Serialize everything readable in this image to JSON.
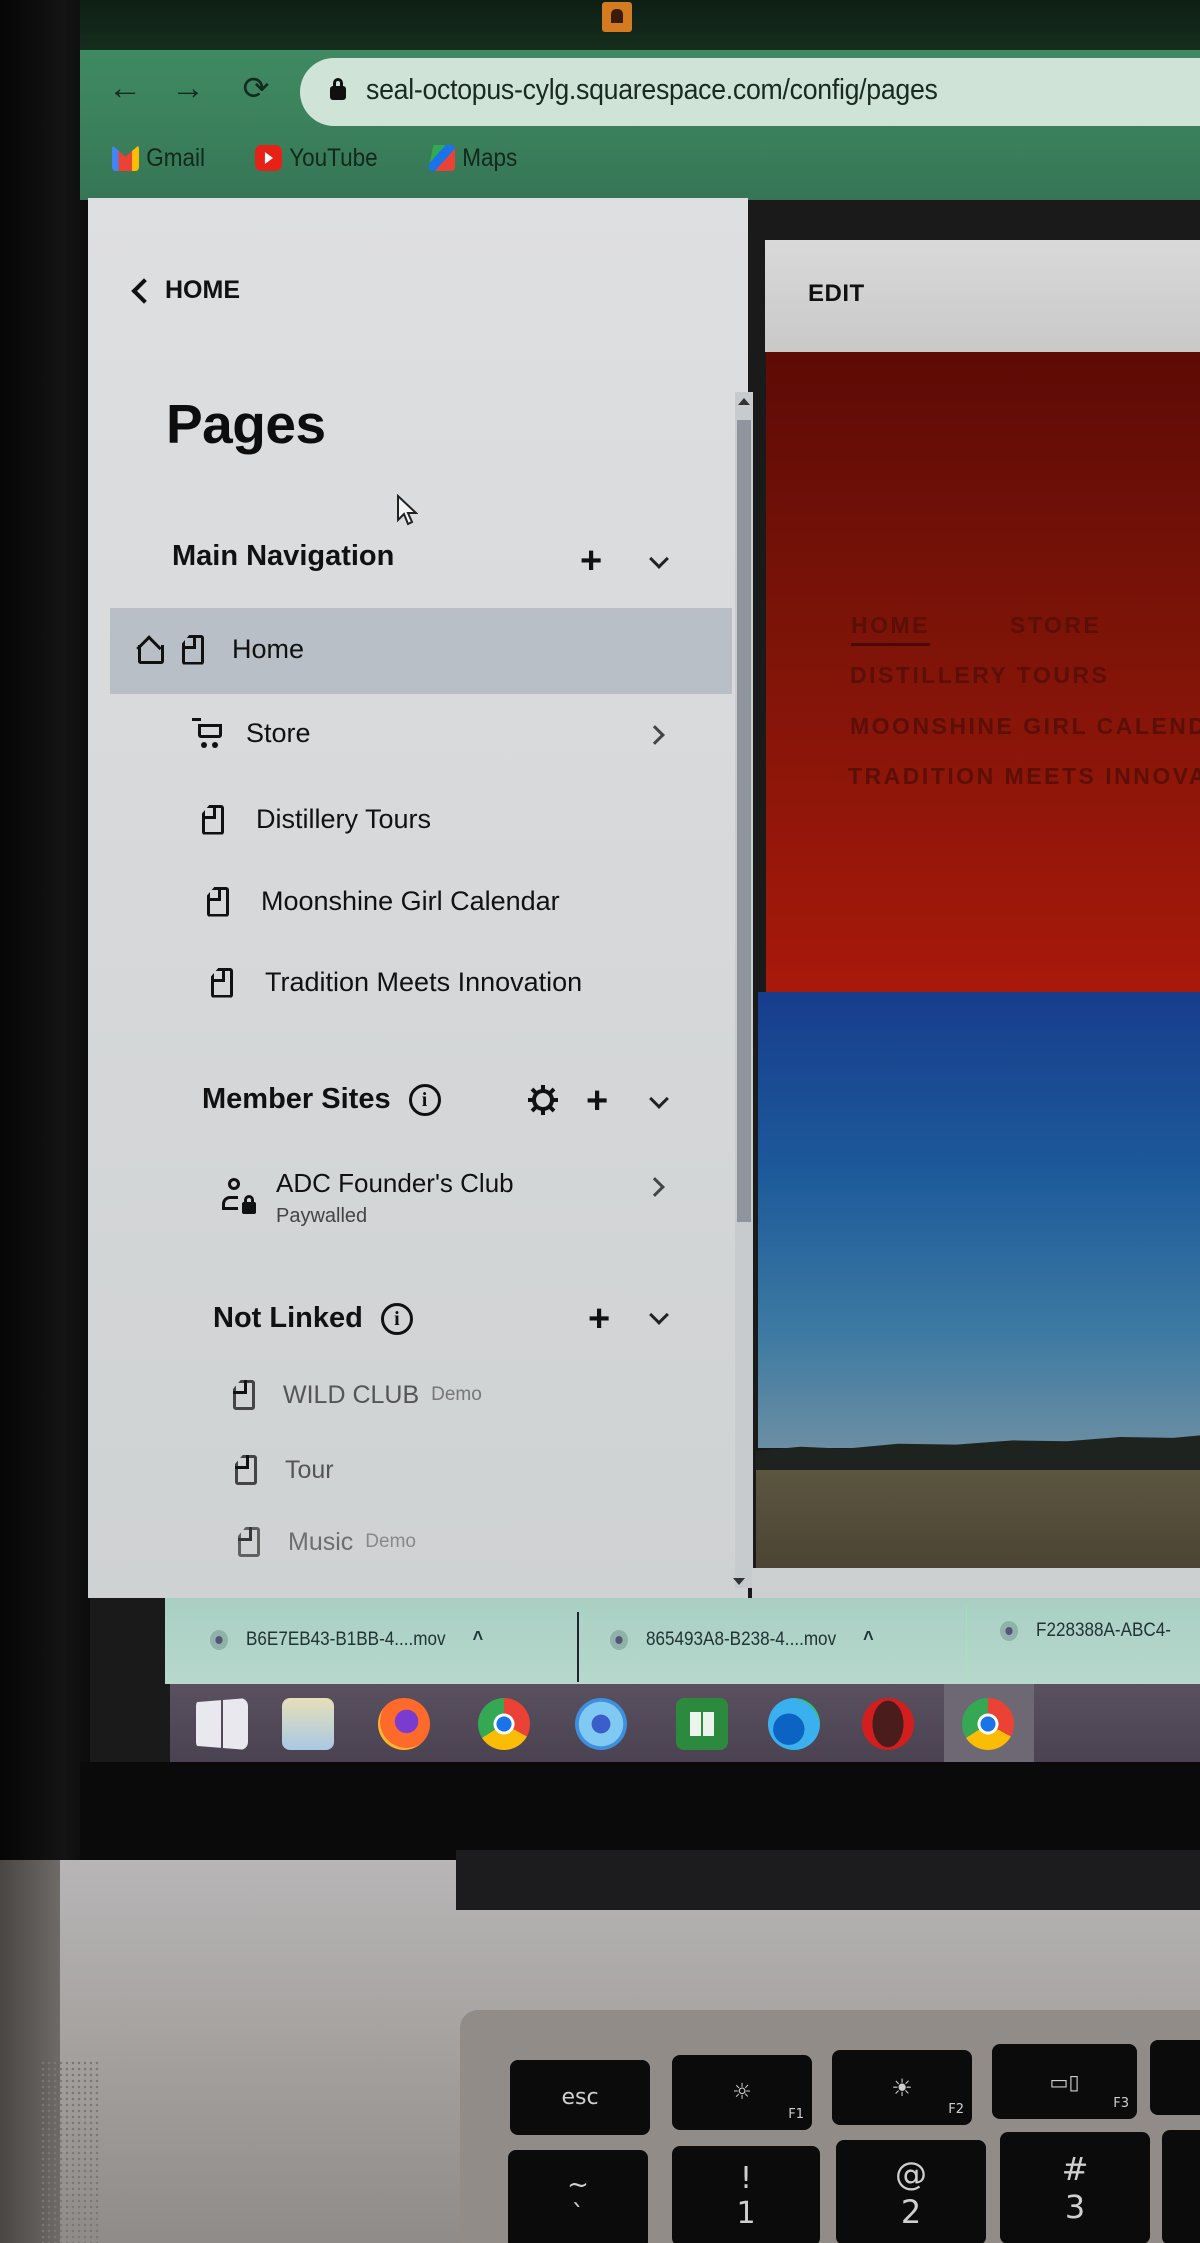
{
  "browser": {
    "url": "seal-octopus-cylg.squarespace.com/config/pages",
    "bookmarks": [
      {
        "label": "Gmail",
        "icon": "gmail-icon"
      },
      {
        "label": "YouTube",
        "icon": "youtube-icon"
      },
      {
        "label": "Maps",
        "icon": "maps-icon"
      }
    ],
    "nav": {
      "back": "←",
      "forward": "→",
      "reload": "⟳"
    }
  },
  "sidebar": {
    "back_label": "HOME",
    "title": "Pages",
    "main_navigation": {
      "label": "Main Navigation",
      "add": "+",
      "items": [
        {
          "label": "Home",
          "icon": "page-icon",
          "is_homepage": true,
          "selected": true
        },
        {
          "label": "Store",
          "icon": "cart-icon",
          "has_children": true
        },
        {
          "label": "Distillery Tours",
          "icon": "page-icon"
        },
        {
          "label": "Moonshine Girl Calendar",
          "icon": "page-icon"
        },
        {
          "label": "Tradition Meets Innovation",
          "icon": "page-icon"
        }
      ]
    },
    "member_sites": {
      "label": "Member Sites",
      "info": "i",
      "add": "+",
      "items": [
        {
          "label": "ADC Founder's Club",
          "sublabel": "Paywalled",
          "icon": "member-lock-icon",
          "has_children": true
        }
      ]
    },
    "not_linked": {
      "label": "Not Linked",
      "info": "i",
      "add": "+",
      "items": [
        {
          "label": "WILD CLUB",
          "badge": "Demo",
          "icon": "page-icon"
        },
        {
          "label": "Tour",
          "badge": "",
          "icon": "page-icon"
        },
        {
          "label": "Music",
          "badge": "Demo",
          "icon": "page-icon"
        }
      ]
    }
  },
  "preview": {
    "edit_label": "EDIT",
    "site_nav": [
      "HOME",
      "STORE",
      "DISTILLERY TOURS",
      "MOONSHINE GIRL CALENDAR",
      "TRADITION MEETS INNOVATION"
    ],
    "colors": {
      "hero_red": "#8a1509",
      "sky_blue": "#1d5a9a",
      "nav_text": "#5b0f07"
    }
  },
  "downloads": [
    {
      "filename": "B6E7EB43-B1BB-4....mov",
      "caret": "^"
    },
    {
      "filename": "865493A8-B238-4....mov",
      "caret": "^"
    },
    {
      "filename": "F228388A-ABC4-",
      "caret": ""
    }
  ],
  "taskbar": [
    "windows-start",
    "file-explorer",
    "firefox",
    "chrome",
    "cortana",
    "microsoft-store",
    "edge",
    "opera",
    "chrome-active"
  ],
  "keyboard": {
    "esc": "esc",
    "f1": {
      "glyph": "☼",
      "fn": "F1"
    },
    "f2": {
      "glyph": "☀",
      "fn": "F2"
    },
    "f3": {
      "glyph": "▭▯",
      "fn": "F3"
    },
    "tilde": {
      "top": "~",
      "bottom": "`"
    },
    "one": {
      "top": "!",
      "bottom": "1"
    },
    "two": {
      "top": "@",
      "bottom": "2"
    },
    "three": {
      "top": "#",
      "bottom": "3"
    }
  }
}
